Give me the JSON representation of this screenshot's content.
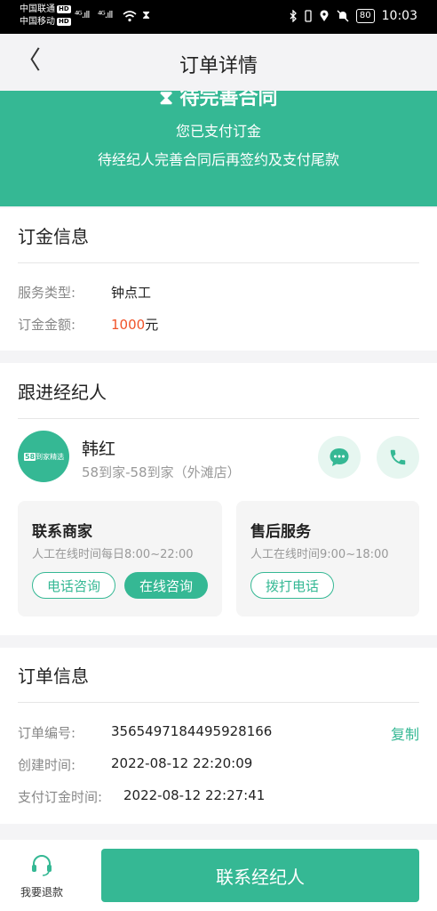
{
  "status_bar": {
    "carrier1": "中国联通",
    "carrier2": "中国移动",
    "hd": "HD",
    "signal1": "⁴ᴳ.ıll",
    "signal2": "⁴ᴳ.ıll",
    "battery": "80",
    "time": "10:03"
  },
  "nav": {
    "title": "订单详情"
  },
  "banner": {
    "title": "待完善合同",
    "line1": "您已支付订金",
    "line2": "待经纪人完善合同后再签约及支付尾款"
  },
  "deposit": {
    "title": "订金信息",
    "service_label": "服务类型:",
    "service_value": "钟点工",
    "amount_label": "订金金额:",
    "amount_value": "1000",
    "amount_unit": "元"
  },
  "agent": {
    "title": "跟进经纪人",
    "logo_badge": "58",
    "logo_text": "到家精选",
    "name": "韩红",
    "store": "58到家-58到家（外滩店）",
    "merchant": {
      "title": "联系商家",
      "hours": "人工在线时间每日8:00~22:00",
      "phone_btn": "电话咨询",
      "online_btn": "在线咨询"
    },
    "aftersales": {
      "title": "售后服务",
      "hours": "人工在线时间9:00~18:00",
      "call_btn": "拨打电话"
    }
  },
  "order": {
    "title": "订单信息",
    "no_label": "订单编号:",
    "no_value": "3565497184495928166",
    "copy": "复制",
    "created_label": "创建时间:",
    "created_value": "2022-08-12 22:20:09",
    "paid_label": "支付订金时间:",
    "paid_value": "2022-08-12 22:27:41"
  },
  "bottom": {
    "refund_label": "我要退款",
    "cta": "联系经纪人"
  },
  "colors": {
    "accent": "#35b894",
    "price": "#f0532a"
  }
}
